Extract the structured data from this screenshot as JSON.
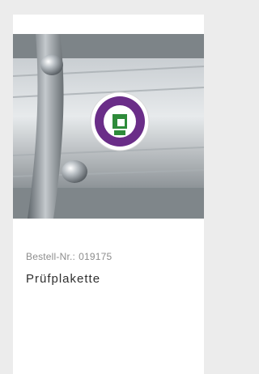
{
  "product": {
    "sku_label": "Bestell-Nr.:",
    "sku_value": "019175",
    "name": "Prüfplakette"
  },
  "image": {
    "subject": "inspection sticker on aluminum profile"
  },
  "colors": {
    "background": "#ececec",
    "card": "#ffffff",
    "sku_text": "#8d8d8d",
    "name_text": "#2f2f2f",
    "sticker_purple": "#6a2d88",
    "sticker_green": "#2e8b3a"
  }
}
